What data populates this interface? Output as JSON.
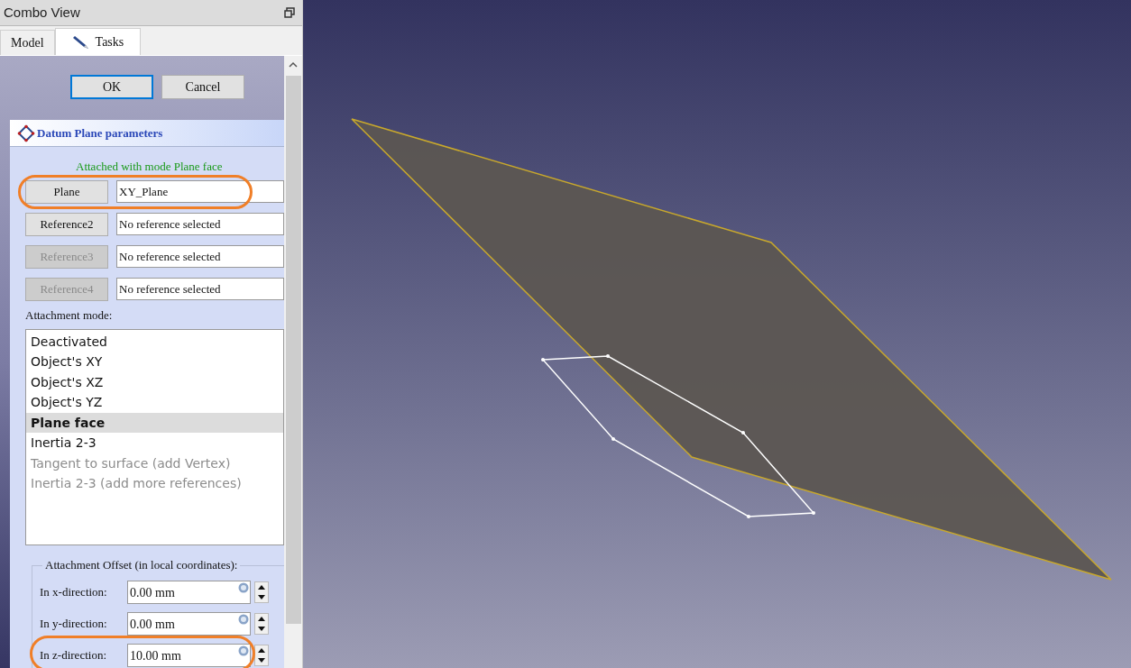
{
  "panel": {
    "title": "Combo View"
  },
  "tabs": [
    {
      "label": "Model",
      "selected": false,
      "icon": false
    },
    {
      "label": "Tasks",
      "selected": true,
      "icon": true
    }
  ],
  "buttons": [
    {
      "label": "OK",
      "focused": true
    },
    {
      "label": "Cancel",
      "focused": false
    }
  ],
  "datum_card": {
    "title": "Datum Plane parameters",
    "status": "Attached with mode Plane face",
    "references": [
      {
        "button": "Plane",
        "value": "XY_Plane",
        "disabled": false,
        "highlighted": true
      },
      {
        "button": "Reference2",
        "value": "No reference selected",
        "disabled": false,
        "highlighted": false
      },
      {
        "button": "Reference3",
        "value": "No reference selected",
        "disabled": true,
        "highlighted": false
      },
      {
        "button": "Reference4",
        "value": "No reference selected",
        "disabled": true,
        "highlighted": false
      }
    ],
    "mode_label": "Attachment mode:",
    "modes": [
      {
        "label": "Deactivated",
        "selected": false,
        "disabled": false
      },
      {
        "label": "Object's XY",
        "selected": false,
        "disabled": false
      },
      {
        "label": "Object's XZ",
        "selected": false,
        "disabled": false
      },
      {
        "label": "Object's YZ",
        "selected": false,
        "disabled": false
      },
      {
        "label": "Plane face",
        "selected": true,
        "disabled": false
      },
      {
        "label": "Inertia 2-3",
        "selected": false,
        "disabled": false
      },
      {
        "label": "Tangent to surface (add Vertex)",
        "selected": false,
        "disabled": true
      },
      {
        "label": "Inertia 2-3 (add more references)",
        "selected": false,
        "disabled": true
      }
    ],
    "offset_title": "Attachment Offset (in local coordinates):",
    "offsets": [
      {
        "label": "In x-direction:",
        "value": "0.00 mm",
        "highlighted": false
      },
      {
        "label": "In y-direction:",
        "value": "0.00 mm",
        "highlighted": false
      },
      {
        "label": "In z-direction:",
        "value": "10.00 mm",
        "highlighted": true
      }
    ]
  }
}
